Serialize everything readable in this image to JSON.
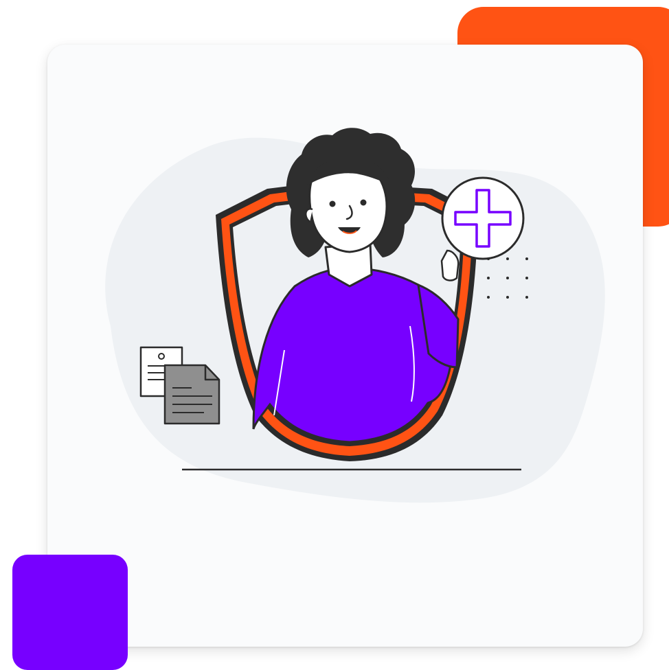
{
  "colors": {
    "accent_orange": "#FF5314",
    "accent_purple": "#7700FF",
    "card_background": "#FAFBFC",
    "blob_background": "#EEF1F4",
    "outline": "#2B2B2B",
    "hair": "#2E2E2E",
    "skin": "#FFFFFF",
    "document_gray": "#8F8F8F"
  },
  "illustration": {
    "subject": "woman-inside-shield",
    "badge_icon": "plus-icon",
    "document_icon": "documents-icon",
    "decoration": "dot-grid"
  }
}
